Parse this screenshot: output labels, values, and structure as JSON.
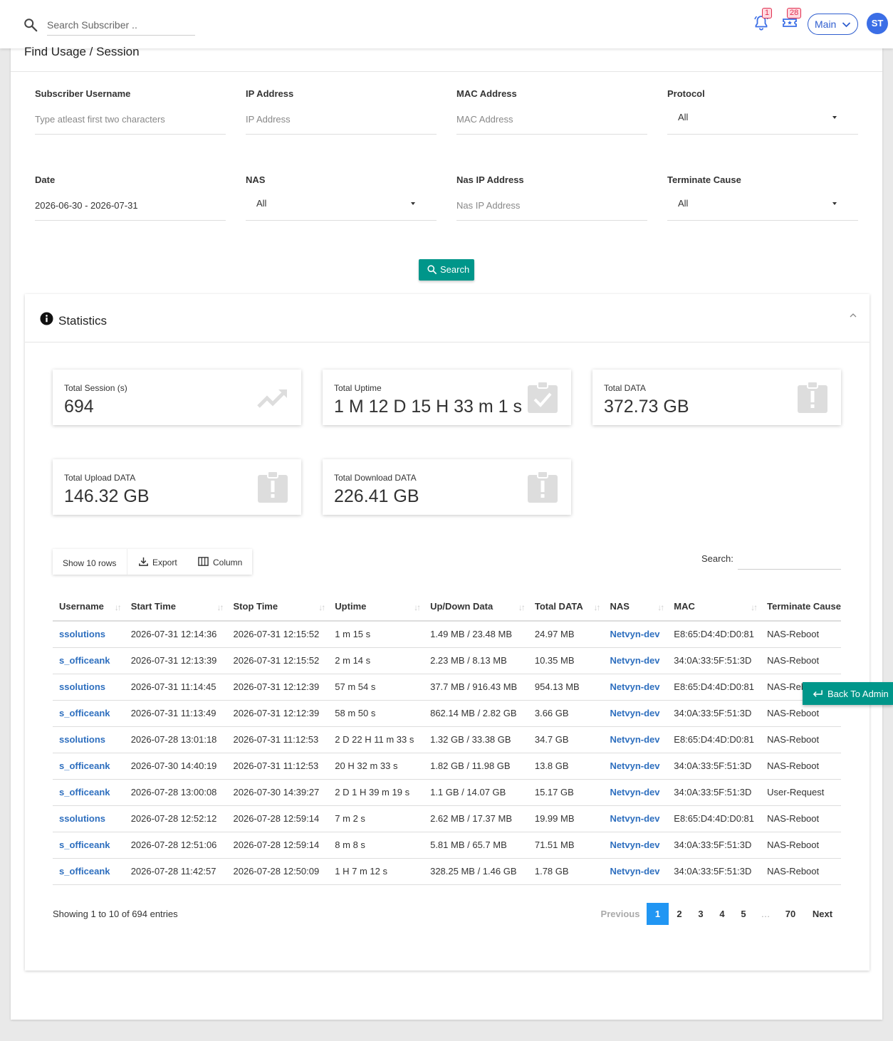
{
  "topbar": {
    "search_placeholder": "Search Subscriber ..",
    "notification_count": "1",
    "ticket_count": "28",
    "branch_select": "Main",
    "avatar_initials": "ST"
  },
  "page": {
    "title": "Find Usage / Session"
  },
  "filters": {
    "username": {
      "label": "Subscriber Username",
      "placeholder": "Type atleast first two characters"
    },
    "ip": {
      "label": "IP Address",
      "placeholder": "IP Address"
    },
    "mac": {
      "label": "MAC Address",
      "placeholder": "MAC Address"
    },
    "protocol": {
      "label": "Protocol",
      "value": "All"
    },
    "date": {
      "label": "Date",
      "value": "2026-06-30 - 2026-07-31"
    },
    "nas": {
      "label": "NAS",
      "value": "All"
    },
    "nas_ip": {
      "label": "Nas IP Address",
      "placeholder": "Nas IP Address"
    },
    "terminate": {
      "label": "Terminate Cause",
      "value": "All"
    },
    "search_button": "Search"
  },
  "statistics": {
    "title": "Statistics",
    "cards": [
      {
        "label": "Total Session (s)",
        "value": "694",
        "icon": "trending-up-icon"
      },
      {
        "label": "Total Uptime",
        "value": "1 M 12 D 15 H 33 m 1 s",
        "icon": "clipboard-check-icon"
      },
      {
        "label": "Total DATA",
        "value": "372.73 GB",
        "icon": "clipboard-alert-icon"
      },
      {
        "label": "Total Upload DATA",
        "value": "146.32 GB",
        "icon": "clipboard-alert-icon"
      },
      {
        "label": "Total Download DATA",
        "value": "226.41 GB",
        "icon": "clipboard-alert-icon"
      }
    ]
  },
  "table": {
    "show_rows": "Show 10 rows",
    "export": "Export",
    "column": "Column",
    "search_label": "Search:",
    "columns": [
      "Username",
      "Start Time",
      "Stop Time",
      "Uptime",
      "Up/Down Data",
      "Total DATA",
      "NAS",
      "MAC",
      "Terminate Cause"
    ],
    "rows": [
      [
        "ssolutions",
        "2026-07-31 12:14:36",
        "2026-07-31 12:15:52",
        "1 m 15 s",
        "1.49 MB / 23.48 MB",
        "24.97 MB",
        "Netvyn-dev",
        "E8:65:D4:4D:D0:81",
        "NAS-Reboot"
      ],
      [
        "s_officeank",
        "2026-07-31 12:13:39",
        "2026-07-31 12:15:52",
        "2 m 14 s",
        "2.23 MB / 8.13 MB",
        "10.35 MB",
        "Netvyn-dev",
        "34:0A:33:5F:51:3D",
        "NAS-Reboot"
      ],
      [
        "ssolutions",
        "2026-07-31 11:14:45",
        "2026-07-31 12:12:39",
        "57 m 54 s",
        "37.7 MB / 916.43 MB",
        "954.13 MB",
        "Netvyn-dev",
        "E8:65:D4:4D:D0:81",
        "NAS-Reboot"
      ],
      [
        "s_officeank",
        "2026-07-31 11:13:49",
        "2026-07-31 12:12:39",
        "58 m 50 s",
        "862.14 MB / 2.82 GB",
        "3.66 GB",
        "Netvyn-dev",
        "34:0A:33:5F:51:3D",
        "NAS-Reboot"
      ],
      [
        "ssolutions",
        "2026-07-28 13:01:18",
        "2026-07-31 11:12:53",
        "2 D 22 H 11 m 33 s",
        "1.32 GB / 33.38 GB",
        "34.7 GB",
        "Netvyn-dev",
        "E8:65:D4:4D:D0:81",
        "NAS-Reboot"
      ],
      [
        "s_officeank",
        "2026-07-30 14:40:19",
        "2026-07-31 11:12:53",
        "20 H 32 m 33 s",
        "1.82 GB / 11.98 GB",
        "13.8 GB",
        "Netvyn-dev",
        "34:0A:33:5F:51:3D",
        "NAS-Reboot"
      ],
      [
        "s_officeank",
        "2026-07-28 13:00:08",
        "2026-07-30 14:39:27",
        "2 D 1 H 39 m 19 s",
        "1.1 GB / 14.07 GB",
        "15.17 GB",
        "Netvyn-dev",
        "34:0A:33:5F:51:3D",
        "User-Request"
      ],
      [
        "ssolutions",
        "2026-07-28 12:52:12",
        "2026-07-28 12:59:14",
        "7 m 2 s",
        "2.62 MB / 17.37 MB",
        "19.99 MB",
        "Netvyn-dev",
        "E8:65:D4:4D:D0:81",
        "NAS-Reboot"
      ],
      [
        "s_officeank",
        "2026-07-28 12:51:06",
        "2026-07-28 12:59:14",
        "8 m 8 s",
        "5.81 MB / 65.7 MB",
        "71.51 MB",
        "Netvyn-dev",
        "34:0A:33:5F:51:3D",
        "NAS-Reboot"
      ],
      [
        "s_officeank",
        "2026-07-28 11:42:57",
        "2026-07-28 12:50:09",
        "1 H 7 m 12 s",
        "328.25 MB / 1.46 GB",
        "1.78 GB",
        "Netvyn-dev",
        "34:0A:33:5F:51:3D",
        "NAS-Reboot"
      ]
    ],
    "showing": "Showing 1 to 10 of 694 entries",
    "pagination": [
      "Previous",
      "1",
      "2",
      "3",
      "4",
      "5",
      "…",
      "70",
      "Next"
    ]
  },
  "back_to_admin": "Back To Admin",
  "colors": {
    "accent": "#00968a",
    "link": "#2e6fbf",
    "primary": "#2196f3",
    "badge": "#e03050"
  }
}
